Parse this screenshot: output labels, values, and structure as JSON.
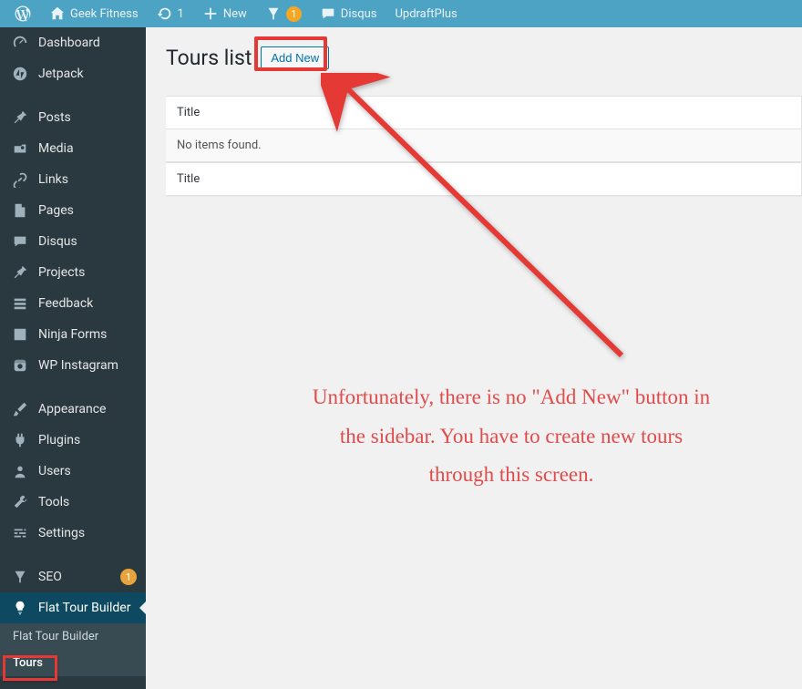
{
  "adminbar": {
    "site_name": "Geek Fitness",
    "updates_count": "1",
    "new_label": "New",
    "yoast_badge": "1",
    "disqus": "Disqus",
    "updraft": "UpdraftPlus"
  },
  "sidebar": {
    "dashboard": "Dashboard",
    "jetpack": "Jetpack",
    "posts": "Posts",
    "media": "Media",
    "links": "Links",
    "pages": "Pages",
    "disqus": "Disqus",
    "projects": "Projects",
    "feedback": "Feedback",
    "ninja": "Ninja Forms",
    "instagram": "WP Instagram",
    "appearance": "Appearance",
    "plugins": "Plugins",
    "users": "Users",
    "tools": "Tools",
    "settings": "Settings",
    "seo": "SEO",
    "seo_badge": "1",
    "ftb": "Flat Tour Builder",
    "sub_ftb": "Flat Tour Builder",
    "sub_tours": "Tours"
  },
  "page": {
    "title": "Tours list",
    "add_new": "Add New",
    "col_title": "Title",
    "empty": "No items found."
  },
  "annotation": {
    "text": "Unfortunately, there is no \"Add New\" button in the sidebar. You have to create new tours through this screen."
  }
}
